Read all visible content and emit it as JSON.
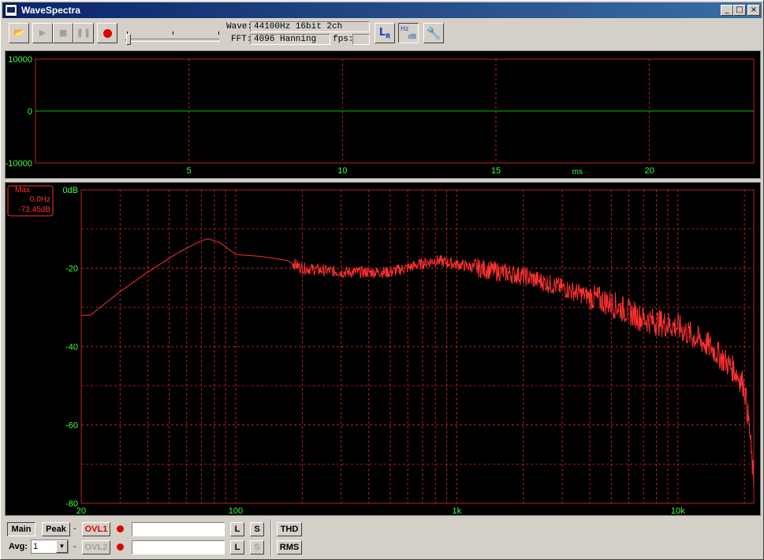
{
  "window": {
    "title": "WaveSpectra",
    "controls": [
      "_",
      "□",
      "×"
    ]
  },
  "toolbar": {
    "open_icon": "open-file-icon",
    "play_icon": "play-icon",
    "stop_icon": "stop-icon",
    "pause_icon": "pause-icon",
    "record_icon": "record-icon",
    "wave_label": "Wave:",
    "wave_value": "44100Hz 16bit 2ch",
    "fft_label": "FFT:",
    "fft_value": "4096 Hanning",
    "fps_label": "fps:",
    "fps_value": "",
    "lr_label": "L",
    "lr_sub": "R",
    "hzdb_top": "Hz",
    "hzdb_bottom": "dB",
    "settings_icon": "wrench-icon"
  },
  "waveform": {
    "y_ticks": [
      "10000",
      "0",
      "-10000"
    ],
    "x_ticks": [
      "5",
      "10",
      "15",
      "20"
    ],
    "x_unit": "ms"
  },
  "spectrum": {
    "y_ticks": [
      "0dB",
      "-20",
      "-40",
      "-60",
      "-80"
    ],
    "x_ticks": [
      "20",
      "100",
      "1k",
      "10k"
    ],
    "max_box": {
      "label": "Max",
      "freq": "0.0Hz",
      "level": "-73.45dB"
    }
  },
  "bottom": {
    "main_label": "Main",
    "peak_label": "Peak",
    "dash1": "-",
    "dash2": "-",
    "ovl1": "OVL1",
    "ovl2": "OVL2",
    "avg_label": "Avg:",
    "avg_value": "1",
    "l_label": "L",
    "s_label": "S",
    "l2_label": "L",
    "s2_label": "S",
    "thd_label": "THD",
    "rms_label": "RMS"
  },
  "colors": {
    "wave_line": "#00c000",
    "grid": "#c02020",
    "spectrum_line": "#ff3030",
    "axis_text": "#40ff40"
  }
}
